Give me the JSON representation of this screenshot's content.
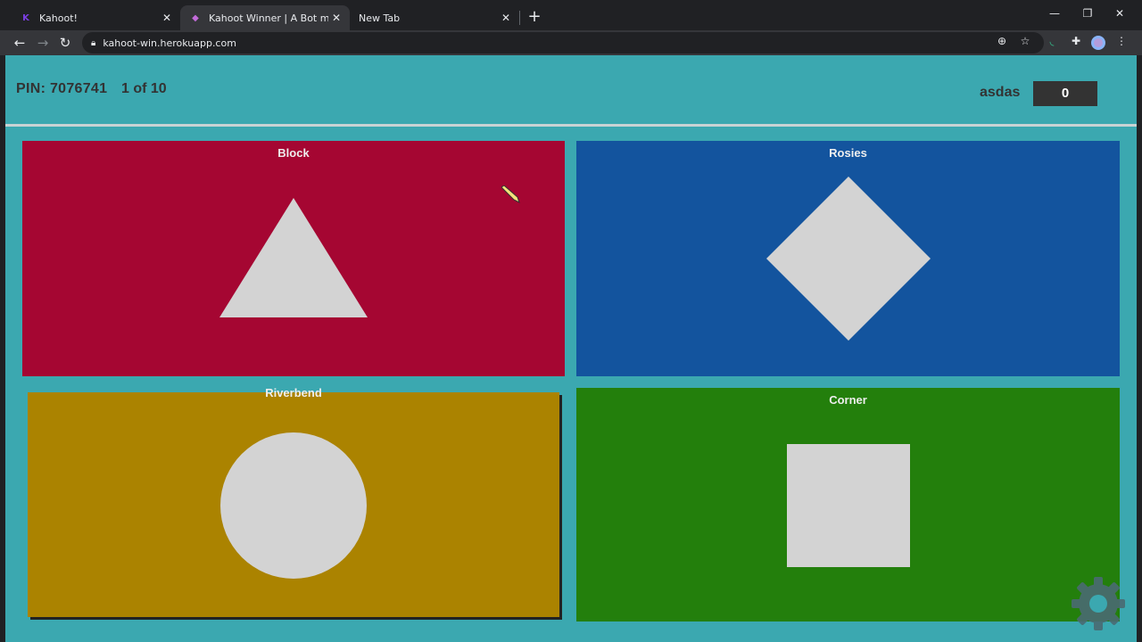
{
  "browser": {
    "tabs": [
      {
        "title": "Kahoot!",
        "favicon": "kahoot-icon"
      },
      {
        "title": "Kahoot Winner | A Bot made by @",
        "favicon": "kahoot-winner-icon"
      },
      {
        "title": "New Tab",
        "favicon": ""
      }
    ],
    "url": "kahoot-win.herokuapp.com"
  },
  "game": {
    "pin_text": "PIN: 7076741",
    "question_text": "1 of 10",
    "username": "asdas",
    "score": "0"
  },
  "answers": [
    {
      "label": "Block",
      "shape": "triangle",
      "color": "#a50632"
    },
    {
      "label": "Rosies",
      "shape": "diamond",
      "color": "#13549e"
    },
    {
      "label": "Riverbend",
      "shape": "circle",
      "color": "#ab8300"
    },
    {
      "label": "Corner",
      "shape": "square",
      "color": "#237f0c"
    }
  ],
  "colors": {
    "page_background": "#3ba8b0",
    "shape_fill": "#d3d3d3"
  }
}
